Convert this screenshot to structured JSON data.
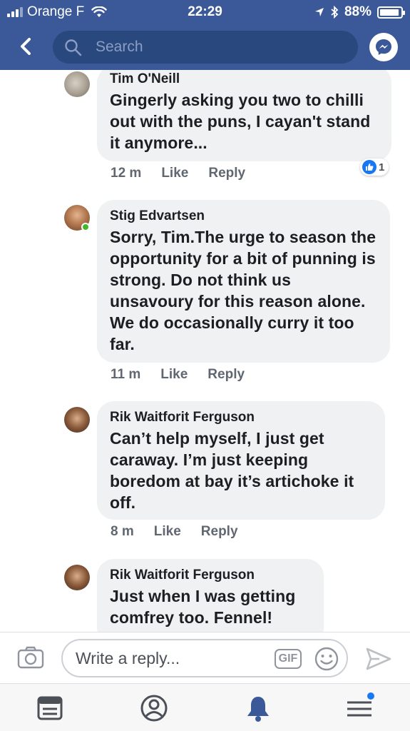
{
  "status_bar": {
    "carrier": "Orange F",
    "time": "22:29",
    "battery": "88%"
  },
  "header": {
    "search_placeholder": "Search"
  },
  "comments": [
    {
      "author": "Tim O'Neill",
      "text": "Gingerly asking you two to chilli out with the puns, I cayan't stand it anymore...",
      "time": "12 m",
      "like_label": "Like",
      "reply_label": "Reply",
      "reaction_count": "1"
    },
    {
      "author": "Stig Edvartsen",
      "text": "Sorry, Tim.The urge to season the opportunity for a bit of punning is strong. Do not think us unsavoury for this reason alone. We do occasionally curry it too far.",
      "time": "11 m",
      "like_label": "Like",
      "reply_label": "Reply"
    },
    {
      "author": "Rik Waitforit Ferguson",
      "text": "Can’t help myself, I just get caraway. I’m just keeping boredom at bay it’s artichoke it off.",
      "time": "8 m",
      "like_label": "Like",
      "reply_label": "Reply"
    },
    {
      "author": "Rik Waitforit Ferguson",
      "text": "Just when I was getting comfrey too. Fennel!"
    }
  ],
  "reply_bar": {
    "placeholder": "Write a reply...",
    "gif_label": "GIF"
  },
  "colors": {
    "brand": "#3b5998",
    "search_bg": "#29487d",
    "bubble": "#f0f1f3",
    "online": "#42b72a",
    "like": "#1877f2"
  },
  "icons": {
    "back": "chevron-left-icon",
    "search": "search-icon",
    "messenger": "messenger-icon",
    "camera": "camera-icon",
    "emoji": "smiley-icon",
    "send": "send-icon",
    "tabs": [
      "news-feed-icon",
      "profile-icon",
      "notifications-icon",
      "menu-icon"
    ]
  }
}
